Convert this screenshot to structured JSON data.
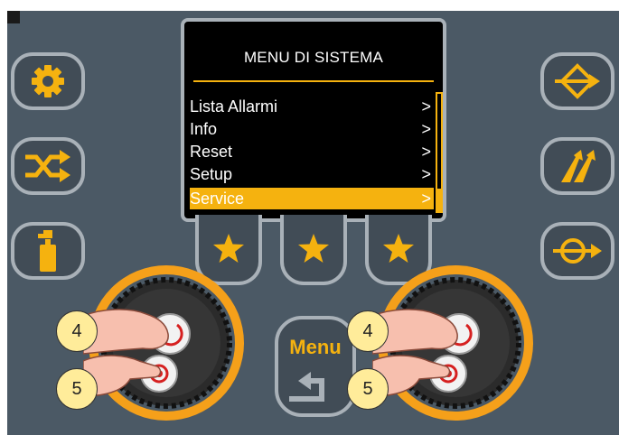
{
  "display": {
    "title": "MENU DI SISTEMA",
    "items": [
      {
        "label": "Lista Allarmi",
        "arrow": ">"
      },
      {
        "label": "Info",
        "arrow": ">"
      },
      {
        "label": "Reset",
        "arrow": ">"
      },
      {
        "label": "Setup",
        "arrow": ">"
      },
      {
        "label": "Service",
        "arrow": ">",
        "selected": true
      }
    ]
  },
  "left_buttons": [
    {
      "icon": "gear-icon"
    },
    {
      "icon": "shuffle-arrows-icon"
    },
    {
      "icon": "spray-can-icon"
    }
  ],
  "right_buttons": [
    {
      "icon": "diamond-arrow-icon"
    },
    {
      "icon": "double-slash-arrows-icon"
    },
    {
      "icon": "loop-arrow-icon"
    }
  ],
  "soft_keys": [
    {
      "icon": "star-icon"
    },
    {
      "icon": "star-icon"
    },
    {
      "icon": "star-icon"
    }
  ],
  "menu_key": {
    "label": "Menu",
    "icon": "return-arrow-icon"
  },
  "knobs": {
    "left": {
      "rotate_badge": "4",
      "press_badge": "5"
    },
    "right": {
      "rotate_badge": "4",
      "press_badge": "5"
    }
  },
  "colors": {
    "panel": "#4b5965",
    "accent": "#f5b20f",
    "button_border": "#a9b1b8",
    "badge": "#ffec9a",
    "lcd_background": "#000000"
  }
}
